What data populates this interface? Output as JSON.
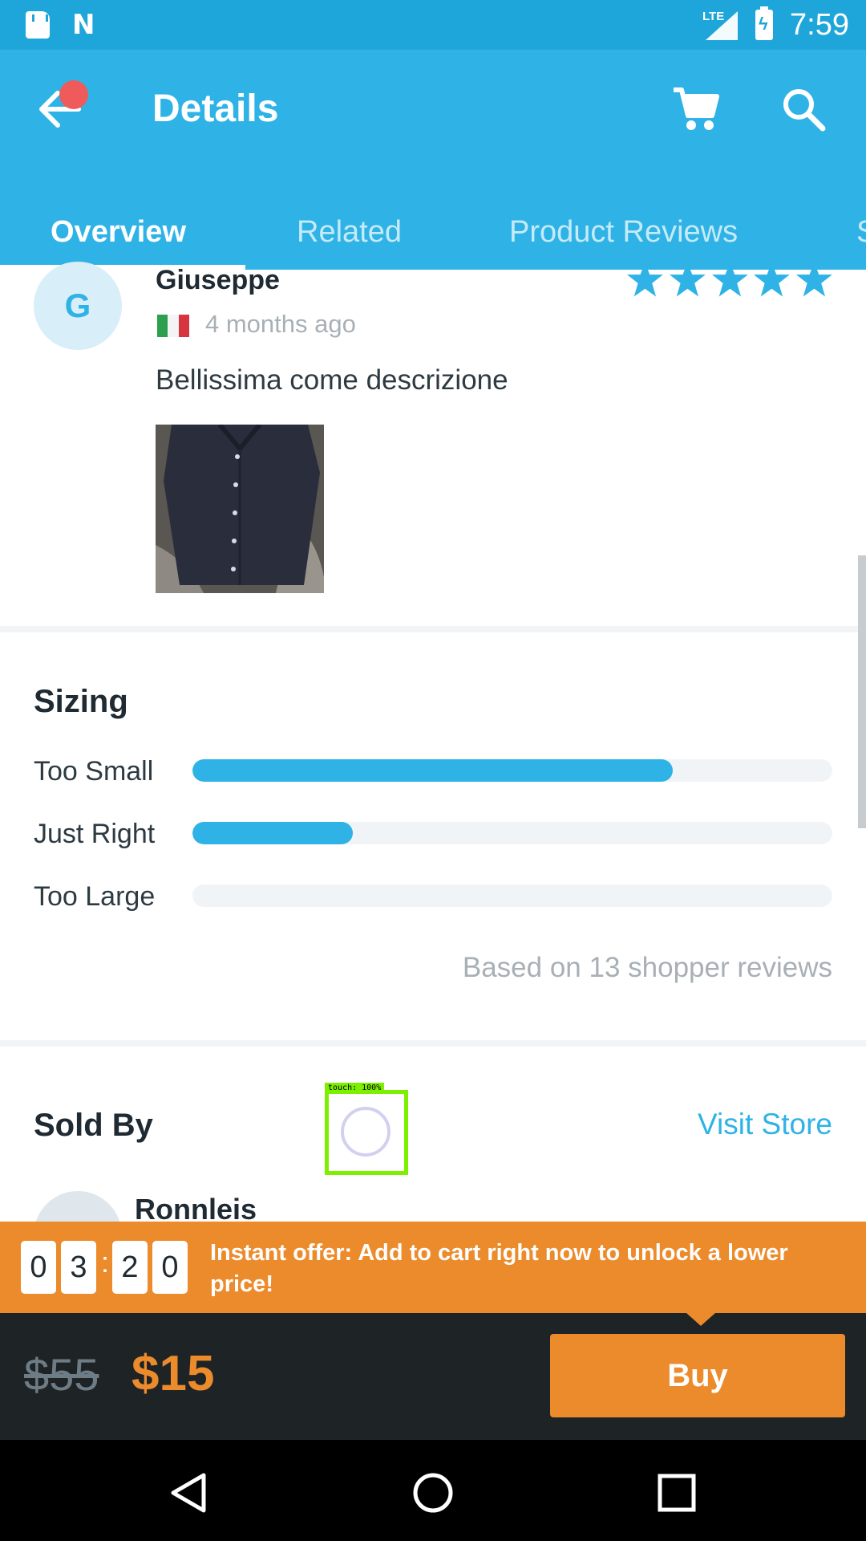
{
  "status_bar": {
    "time": "7:59",
    "network": "LTE"
  },
  "header": {
    "title": "Details"
  },
  "tabs": [
    {
      "label": "Overview"
    },
    {
      "label": "Related"
    },
    {
      "label": "Product Reviews"
    },
    {
      "label": "S"
    }
  ],
  "review": {
    "avatar_initial": "G",
    "name": "Giuseppe",
    "rating": 5,
    "time": "4 months ago",
    "text": "Bellissima come descrizione",
    "flag": "italy-flag"
  },
  "sizing": {
    "title": "Sizing",
    "rows": [
      {
        "label": "Too Small",
        "fill": 0.75
      },
      {
        "label": "Just Right",
        "fill": 0.25
      },
      {
        "label": "Too Large",
        "fill": 0
      }
    ],
    "review_count_text": "Based on 13 shopper reviews"
  },
  "sold_by": {
    "title": "Sold By",
    "visit_store": "Visit Store",
    "store_name": "Ronnleis"
  },
  "touch_overlay": {
    "label": "touch: 100%"
  },
  "offer": {
    "digits": [
      "0",
      "3",
      "2",
      "0"
    ],
    "separator": ":",
    "text": "Instant offer: Add to cart right now to unlock a lower price!"
  },
  "purchase": {
    "old_price": "$55",
    "new_price": "$15",
    "buy_label": "Buy"
  },
  "colors": {
    "primary": "#2fb3e6",
    "status_bar": "#1ea6da",
    "offer": "#ec8b2c",
    "buy_bar": "#1e2326"
  }
}
